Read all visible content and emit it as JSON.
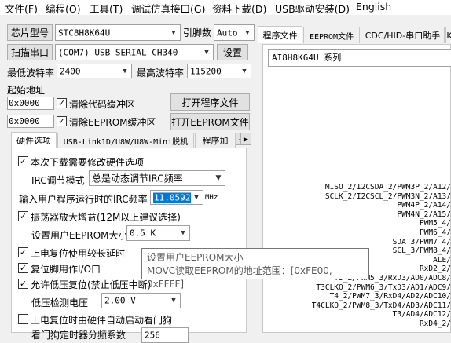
{
  "menu": [
    "文件(F)",
    "编程(O)",
    "工具(T)",
    "调试仿真接口(G)",
    "资料下载(D)",
    "USB驱动安装(D)",
    "English"
  ],
  "top": {
    "chip_type_btn": "芯片型号",
    "chip_type_value": "STC8H8K64U",
    "pin_count_label": "引脚数",
    "pin_count_value": "Auto",
    "scan_btn": "扫描串口",
    "port_value": "(COM7) USB-SERIAL CH340",
    "settings_btn": "设置",
    "min_baud_label": "最低波特率",
    "min_baud_value": "2400",
    "max_baud_label": "最高波特率",
    "max_baud_value": "115200",
    "start_addr_label": "起始地址",
    "addr1_value": "0x0000",
    "clear_code_label": "清除代码缓冲区",
    "open_prog_btn": "打开程序文件",
    "addr2_value": "0x0000",
    "clear_eeprom_label": "清除EEPROM缓冲区",
    "open_eeprom_btn": "打开EEPROM文件"
  },
  "left_tabs": [
    "硬件选项",
    "USB-Link1D/U8W/U8W-Mini脱机",
    "程序加"
  ],
  "options": {
    "reset_hw_label": "本次下载需要修改硬件选项",
    "irc_mode_label": "IRC调节模式",
    "irc_mode_value": "总是动态调节IRC频率",
    "irc_freq_label": "输入用户程序运行时的IRC频率",
    "irc_freq_value": "11.0592",
    "irc_freq_unit": "MHz",
    "osc_gain_label": "振荡器放大增益(12M以上建议选择)",
    "eeprom_size_label": "设置用户EEPROM大小",
    "eeprom_size_value": "0.5 K",
    "long_reset_label": "上电复位使用较长延时",
    "reset_pin_label": "复位脚用作I/O口",
    "lvd_reset_label": "允许低压复位(禁止低压中断)",
    "lvd_voltage_label": "低压检测电压",
    "lvd_voltage_value": "2.00 V",
    "watchdog_label": "上电复位时由硬件自动启动看门狗",
    "partial_label": "看门狗定时器分频系数",
    "partial_value": "256"
  },
  "tooltip": {
    "line1": "设置用户EEPROM大小",
    "line2": "MOVC读取EEPROM的地址范围：[0xFE00, 0xFFFF]"
  },
  "right_tabs": [
    "程序文件",
    "EEPROM文件",
    "CDC/HID-串口助手",
    "K"
  ],
  "chip_title": "AI8H8K64U 系列",
  "pins": [
    "MISO_2/I2CSDA_2/PWM3P_2/A12/",
    "SCLK_2/I2CSCL_2/PWM3N_2/A13/",
    "PWM4P_2/A14/",
    "PWM4N_2/A15/",
    "PWM5_4/",
    "PWM6_4/",
    "SDA_3/PWM7_4/",
    "SCL_3/PWM8_4/",
    "ALE/",
    "RxD2_2/",
    "T3_2/PWM5_3/RxD3/AD0/ADC8/",
    "T3CLKO_2/PWM6_3/TxD3/AD1/ADC9/",
    "T4_2/PWM7_3/RxD4/AD2/ADC10/",
    "T4CLKO_2/PWM8_3/TxD4/AD3/ADC11/",
    "T3/AD4/ADC12/",
    "RxD4_2/"
  ],
  "checks": {
    "clear_code": true,
    "clear_eeprom": true,
    "reset_hw": true,
    "osc_gain": true,
    "long_reset": true,
    "reset_pin": true,
    "lvd_reset": true,
    "watchdog": false
  }
}
